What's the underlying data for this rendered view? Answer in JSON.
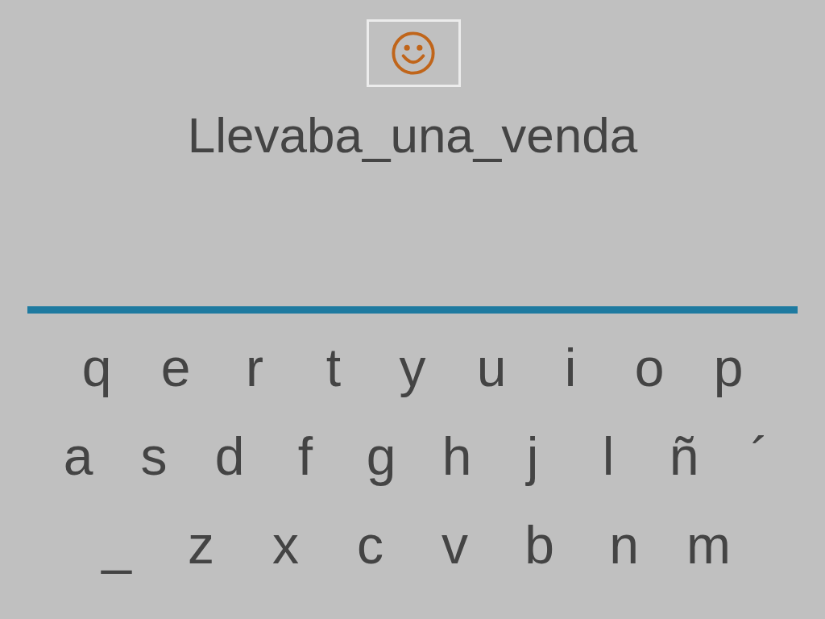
{
  "phrase": "Llevaba_una_venda",
  "keyboard": {
    "rows": [
      [
        "q",
        "e",
        "r",
        "t",
        "y",
        "u",
        "i",
        "o",
        "p"
      ],
      [
        "a",
        "s",
        "d",
        "f",
        "g",
        "h",
        "j",
        "l",
        "ñ",
        "´"
      ],
      [
        "_",
        "z",
        "x",
        "c",
        "v",
        "b",
        "n",
        "m"
      ]
    ]
  }
}
